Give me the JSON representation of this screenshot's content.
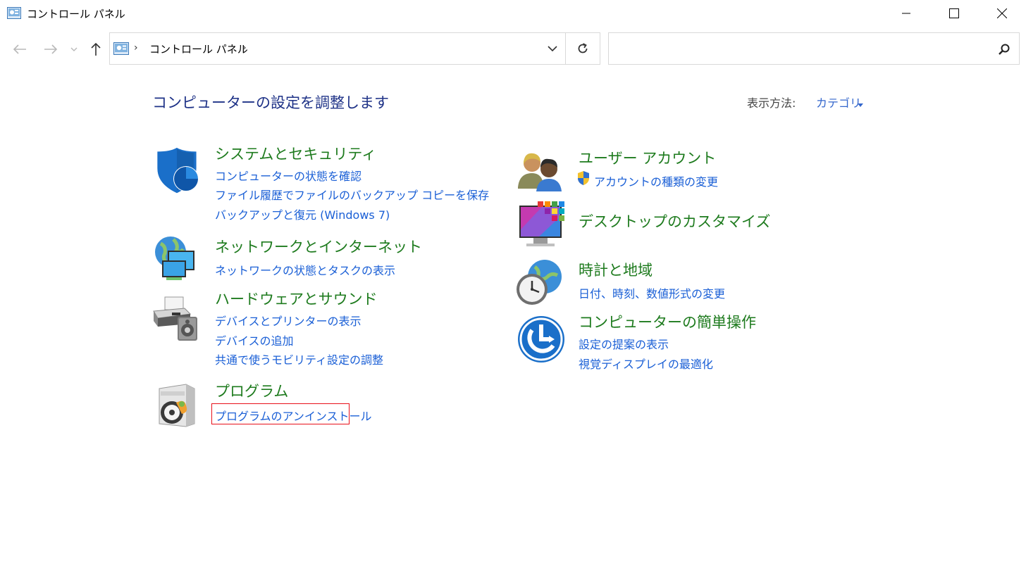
{
  "window": {
    "title": "コントロール パネル"
  },
  "address": {
    "separator": "›",
    "crumb": "コントロール パネル"
  },
  "search": {
    "placeholder": "",
    "value": ""
  },
  "header": {
    "title": "コンピューターの設定を調整します",
    "view_label": "表示方法:",
    "view_value": "カテゴリ"
  },
  "categories": {
    "system": {
      "title": "システムとセキュリティ",
      "links": [
        "コンピューターの状態を確認",
        "ファイル履歴でファイルのバックアップ コピーを保存",
        "バックアップと復元 (Windows 7)"
      ]
    },
    "network": {
      "title": "ネットワークとインターネット",
      "links": [
        "ネットワークの状態とタスクの表示"
      ]
    },
    "hardware": {
      "title": "ハードウェアとサウンド",
      "links": [
        "デバイスとプリンターの表示",
        "デバイスの追加",
        "共通で使うモビリティ設定の調整"
      ]
    },
    "programs": {
      "title": "プログラム",
      "links": [
        "プログラムのアンインストール"
      ]
    },
    "users": {
      "title": "ユーザー アカウント",
      "links": [
        "アカウントの種類の変更"
      ]
    },
    "desktop": {
      "title": "デスクトップのカスタマイズ",
      "links": []
    },
    "clock": {
      "title": "時計と地域",
      "links": [
        "日付、時刻、数値形式の変更"
      ]
    },
    "ease": {
      "title": "コンピューターの簡単操作",
      "links": [
        "設定の提案の表示",
        "視覚ディスプレイの最適化"
      ]
    }
  },
  "colors": {
    "title_blue": "#1e3287",
    "category_green": "#1e7b1e",
    "link_blue": "#1a5fd6",
    "highlight_red": "#e8101a"
  },
  "icons": {
    "title": "control-panel-icon",
    "back": "arrow-left-icon",
    "forward": "arrow-right-icon",
    "recent": "chevron-down-icon",
    "up": "arrow-up-icon",
    "dropdown": "chevron-down-icon",
    "refresh": "refresh-icon",
    "search": "search-icon"
  }
}
